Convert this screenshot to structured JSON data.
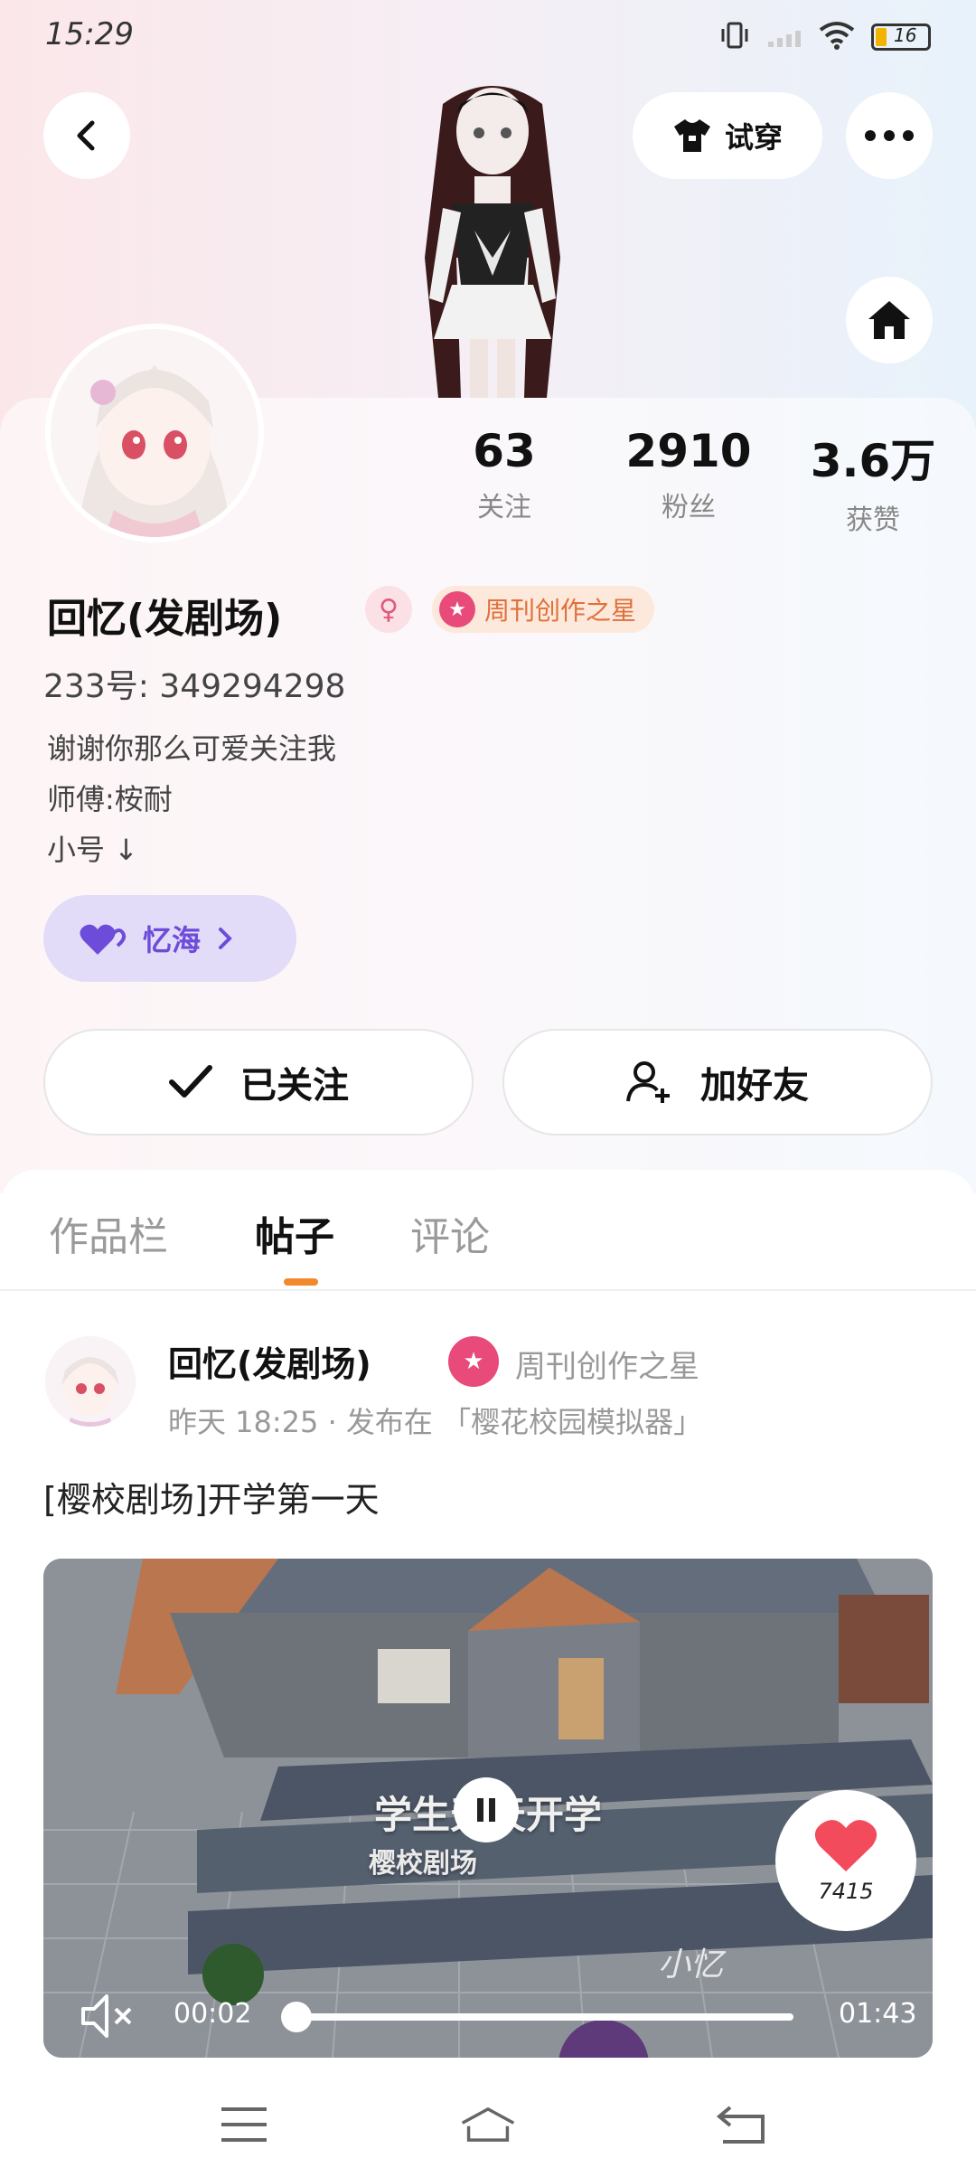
{
  "status_bar": {
    "time": "15:29",
    "battery": "16"
  },
  "top_actions": {
    "try_on_label": "试穿"
  },
  "stats": [
    {
      "value": "63",
      "label": "关注"
    },
    {
      "value": "2910",
      "label": "粉丝"
    },
    {
      "value": "3.6万",
      "label": "获赞"
    }
  ],
  "profile": {
    "name": "回忆(发剧场)",
    "badge": "周刊创作之星",
    "uid": "233号: 349294298",
    "bio": [
      "谢谢你那么可爱关注我",
      "师傅:桉耐",
      "小号 ↓"
    ],
    "yihai_label": "忆海"
  },
  "actions": {
    "followed_label": "已关注",
    "add_friend_label": "加好友"
  },
  "tabs": [
    "作品栏",
    "帖子",
    "评论"
  ],
  "post": {
    "author": "回忆(发剧场)",
    "badge": "周刊创作之星",
    "meta": "昨天 18:25 · 发布在 「樱花校园模拟器」",
    "title": "[樱校剧场]开学第一天",
    "video_overlay_title": "学生天天开学",
    "video_overlay_sub": "樱校剧场",
    "video_signature": "小忆",
    "likes": "7415",
    "time_current": "00:02",
    "time_total": "01:43",
    "progress": 0.0
  },
  "colors": {
    "accent": "#f08a2c",
    "brand_purple": "#6c4cd8",
    "like_red": "#f24b5b"
  }
}
